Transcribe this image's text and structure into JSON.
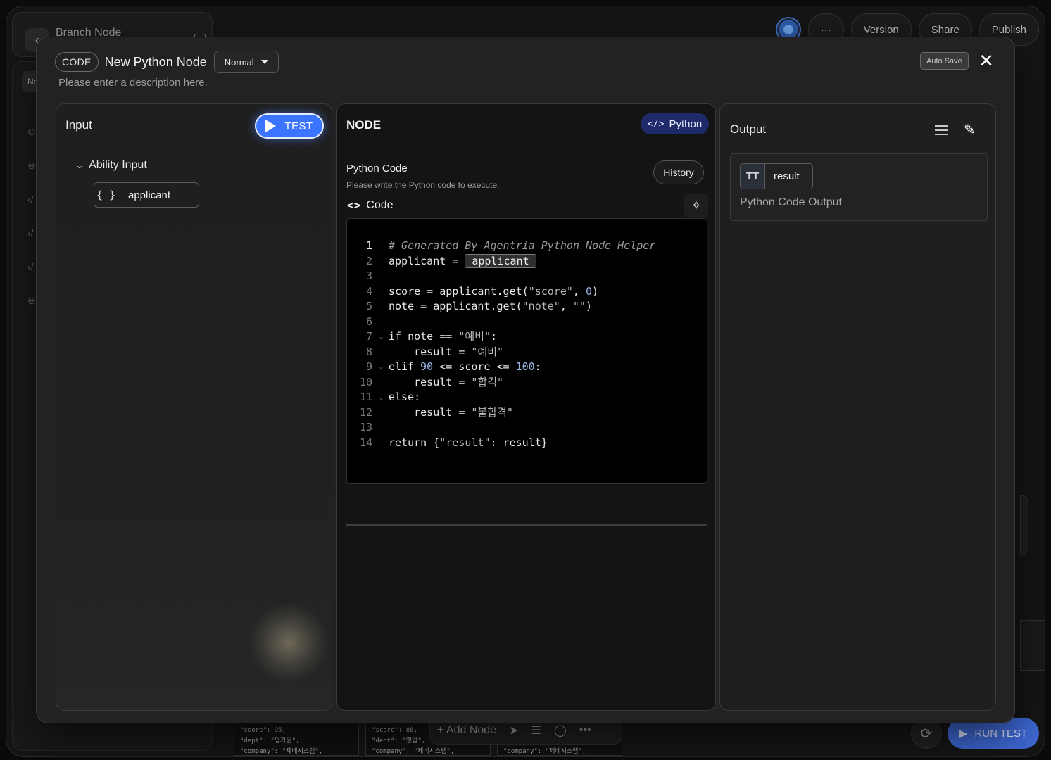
{
  "background": {
    "breadcrumb_title": "Branch Node",
    "left_tab_label": "No",
    "top_buttons": {
      "more": "···",
      "version": "Version",
      "share": "Share",
      "publish": "Publish"
    },
    "bottom_cards": [
      {
        "line1": "\"score\": 95,",
        "line2": "\"dept\": \"평가원\",",
        "line3": "\"company\": \"제네시스랩\","
      },
      {
        "line1": "\"score\": 88,",
        "line2": "\"dept\": \"영업\",",
        "line3": "\"company\": \"제네시스랩\","
      },
      {
        "line1": "",
        "line2": "",
        "line3": "\"company\": \"제네시스랩\","
      }
    ],
    "toolbar": {
      "add_node": "+ Add Node"
    },
    "run_test": "RUN TEST"
  },
  "modal": {
    "type_tag": "CODE",
    "title": "New Python Node",
    "mode": "Normal",
    "description_placeholder": "Please enter a description here.",
    "autosave_label": "Auto Save"
  },
  "input_panel": {
    "title": "Input",
    "test_button": "TEST",
    "group_label": "Ability Input",
    "variable": {
      "icon": "{ }",
      "name": "applicant"
    }
  },
  "node_panel": {
    "title": "NODE",
    "language_badge": "Python",
    "language_icon": "</>",
    "section_title": "Python Code",
    "section_subtitle": "Please write the Python code to execute.",
    "history_button": "History",
    "code_label": "Code",
    "code_lines": [
      {
        "n": "1",
        "fold": "",
        "active": true
      },
      {
        "n": "2",
        "fold": ""
      },
      {
        "n": "3",
        "fold": ""
      },
      {
        "n": "4",
        "fold": ""
      },
      {
        "n": "5",
        "fold": ""
      },
      {
        "n": "6",
        "fold": ""
      },
      {
        "n": "7",
        "fold": "⌄"
      },
      {
        "n": "8",
        "fold": ""
      },
      {
        "n": "9",
        "fold": "⌄"
      },
      {
        "n": "10",
        "fold": ""
      },
      {
        "n": "11",
        "fold": "⌄"
      },
      {
        "n": "12",
        "fold": ""
      },
      {
        "n": "13",
        "fold": ""
      },
      {
        "n": "14",
        "fold": ""
      }
    ],
    "code": {
      "l1": "# Generated By Agentria Python Node Helper",
      "l2a": "applicant = ",
      "l2var": "applicant",
      "l4a": "score = applicant.get(",
      "l4s": "\"score\"",
      "l4b": ", ",
      "l4n": "0",
      "l4c": ")",
      "l5a": "note = applicant.get(",
      "l5s": "\"note\"",
      "l5b": ", ",
      "l5s2": "\"\"",
      "l5c": ")",
      "l7a": "if note == ",
      "l7s": "\"예비\"",
      "l7b": ":",
      "l8a": "    result = ",
      "l8s": "\"예비\"",
      "l9a": "elif ",
      "l9n": "90",
      "l9b": " <= score <= ",
      "l9n2": "100",
      "l9c": ":",
      "l10a": "    result = ",
      "l10s": "\"합격\"",
      "l11a": "else:",
      "l12a": "    result = ",
      "l12s": "\"불합격\"",
      "l14a": "return {",
      "l14s": "\"result\"",
      "l14b": ": result}"
    }
  },
  "output_panel": {
    "title": "Output",
    "variable": {
      "icon": "TT",
      "name": "result"
    },
    "placeholder": "Python Code Output"
  },
  "colors": {
    "accent": "#3b74ff",
    "python_badge": "#1f2a6b",
    "run_test": "#3f69d6"
  }
}
